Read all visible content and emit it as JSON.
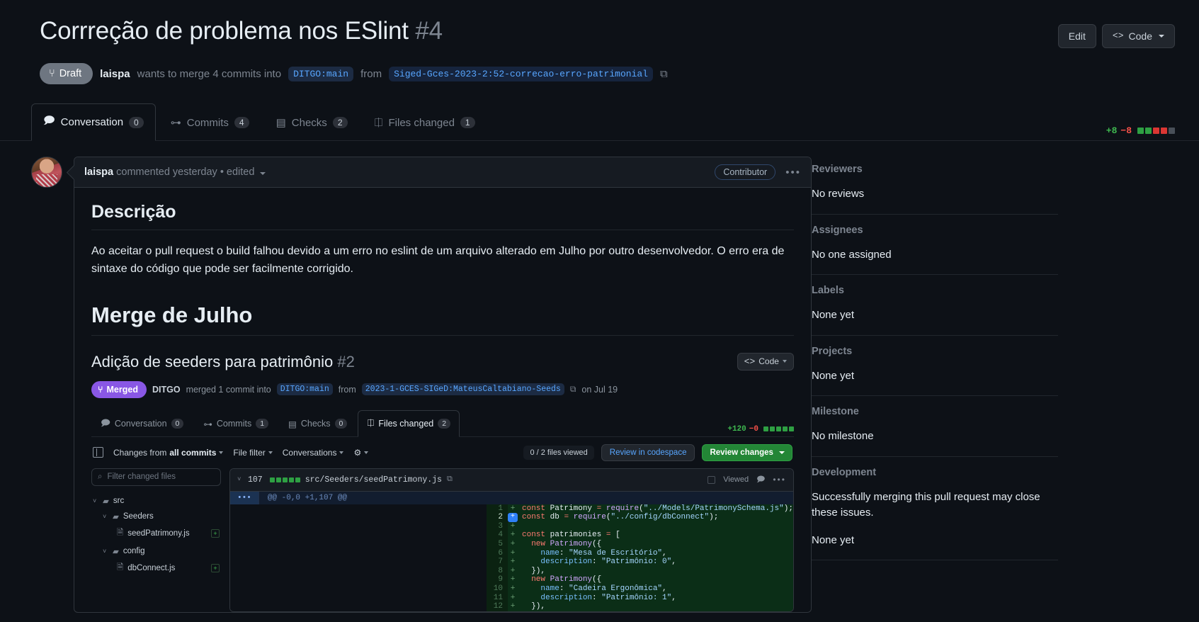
{
  "header": {
    "title": "Corrreção de problema nos ESlint",
    "number": "#4",
    "edit_label": "Edit",
    "code_label": "Code",
    "draft_label": "Draft",
    "author": "laispa",
    "merge_text": "wants to merge 4 commits into",
    "base_branch": "DITGO:main",
    "from_label": "from",
    "head_branch": "Siged-Gces-2023-2:52-correcao-erro-patrimonial"
  },
  "tabs": [
    {
      "label": "Conversation",
      "count": "0",
      "icon": "comment-icon",
      "active": true
    },
    {
      "label": "Commits",
      "count": "4",
      "icon": "commit-icon",
      "active": false
    },
    {
      "label": "Checks",
      "count": "2",
      "icon": "checks-icon",
      "active": false
    },
    {
      "label": "Files changed",
      "count": "1",
      "icon": "file-diff-icon",
      "active": false
    }
  ],
  "diffstat": {
    "additions": "+8",
    "deletions": "−8",
    "blocks": [
      "g",
      "g",
      "r",
      "r",
      "n"
    ]
  },
  "comment": {
    "author": "laispa",
    "meta": "commented yesterday • edited",
    "badge": "Contributor",
    "heading_description": "Descrição",
    "paragraph": "Ao aceitar o pull request o build falhou devido a um erro no eslint de um arquivo alterado em Julho por outro desenvolvedor. O erro era de sintaxe do código que pode ser facilmente corrigido.",
    "heading_merge": "Merge de Julho"
  },
  "embed": {
    "title": "Adição de seeders para patrimônio",
    "number": "#2",
    "code_label": "Code",
    "merged_label": "Merged",
    "merged_by": "DITGO",
    "merged_text": "merged 1 commit into",
    "base_branch": "DITGO:main",
    "from_label": "from",
    "head_branch": "2023-1-GCES-SIGeD:MateusCaltabiano-Seeds",
    "date": "on Jul 19",
    "tabs": [
      {
        "label": "Conversation",
        "count": "0",
        "active": false
      },
      {
        "label": "Commits",
        "count": "1",
        "active": false
      },
      {
        "label": "Checks",
        "count": "0",
        "active": false
      },
      {
        "label": "Files changed",
        "count": "2",
        "active": true
      }
    ],
    "diffstat": {
      "additions": "+120",
      "deletions": "−0",
      "blocks": [
        "g",
        "g",
        "g",
        "g",
        "g"
      ]
    },
    "toolbar": {
      "changes_from": "Changes from",
      "changes_from_bold": "all commits",
      "file_filter": "File filter",
      "conversations": "Conversations",
      "files_viewed": "0 / 2 files viewed",
      "review_codespace": "Review in codespace",
      "review_changes": "Review changes"
    },
    "filter_placeholder": "Filter changed files",
    "tree": [
      {
        "label": "src",
        "type": "folder",
        "depth": 0,
        "added": false
      },
      {
        "label": "Seeders",
        "type": "folder",
        "depth": 1,
        "added": false
      },
      {
        "label": "seedPatrimony.js",
        "type": "file",
        "depth": 2,
        "added": true
      },
      {
        "label": "config",
        "type": "folder",
        "depth": 1,
        "added": false
      },
      {
        "label": "dbConnect.js",
        "type": "file",
        "depth": 2,
        "added": true
      }
    ],
    "file": {
      "changes": "107",
      "blocks": [
        "g",
        "g",
        "g",
        "g",
        "g"
      ],
      "path": "src/Seeders/seedPatrimony.js",
      "viewed_label": "Viewed",
      "hunk": "@@ -0,0 +1,107 @@"
    },
    "code_lines": [
      {
        "n": "1",
        "sign": "+",
        "text": "const Patrimony = require(\"../Models/PatrimonySchema.js\");"
      },
      {
        "n": "2",
        "sign": "+",
        "text": "const db = require(\"../config/dbConnect\");",
        "highlighted": true
      },
      {
        "n": "3",
        "sign": "+",
        "text": ""
      },
      {
        "n": "4",
        "sign": "+",
        "text": "const patrimonies = ["
      },
      {
        "n": "5",
        "sign": "+",
        "text": "  new Patrimony({"
      },
      {
        "n": "6",
        "sign": "+",
        "text": "    name: \"Mesa de Escritório\","
      },
      {
        "n": "7",
        "sign": "+",
        "text": "    description: \"Patrimônio: 0\","
      },
      {
        "n": "8",
        "sign": "+",
        "text": "  }),"
      },
      {
        "n": "9",
        "sign": "+",
        "text": "  new Patrimony({"
      },
      {
        "n": "10",
        "sign": "+",
        "text": "    name: \"Cadeira Ergonômica\","
      },
      {
        "n": "11",
        "sign": "+",
        "text": "    description: \"Patrimônio: 1\","
      },
      {
        "n": "12",
        "sign": "+",
        "text": "  }),"
      }
    ]
  },
  "sidebar": [
    {
      "title": "Reviewers",
      "value": "No reviews"
    },
    {
      "title": "Assignees",
      "value": "No one assigned"
    },
    {
      "title": "Labels",
      "value": "None yet"
    },
    {
      "title": "Projects",
      "value": "None yet"
    },
    {
      "title": "Milestone",
      "value": "No milestone"
    },
    {
      "title": "Development",
      "value": "Successfully merging this pull request may close these issues.",
      "value2": "None yet"
    }
  ],
  "colors": {
    "accent": "#58a6ff",
    "green": "#3fb950",
    "red": "#f85149",
    "purple": "#8957e5",
    "bg": "#0d1117"
  }
}
